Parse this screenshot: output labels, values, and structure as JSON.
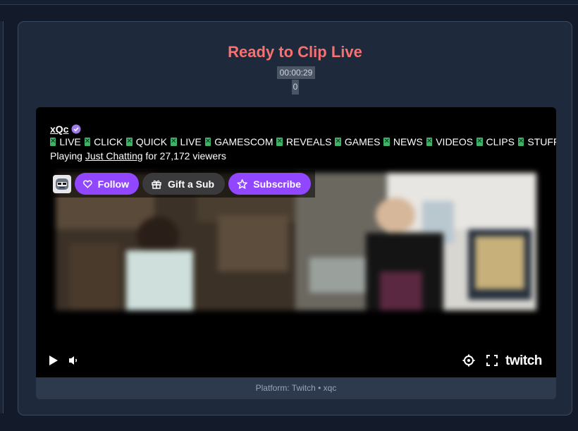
{
  "header": {
    "title": "Ready to Clip Live",
    "timer": "00:00:29",
    "counter": "0"
  },
  "stream": {
    "channel": "xQc",
    "title_words": [
      "LIVE",
      "CLICK",
      "QUICK",
      "LIVE",
      "GAMESCOM",
      "REVEALS",
      "GAMES",
      "NEWS",
      "VIDEOS",
      "CLIPS",
      "STUFF"
    ],
    "playing_prefix": "Playing",
    "game": "Just Chatting",
    "viewers_text": "for 27,172 viewers"
  },
  "actions": {
    "follow_label": "Follow",
    "gift_label": "Gift a Sub",
    "subscribe_label": "Subscribe"
  },
  "controls": {
    "play_icon": "play-icon",
    "volume_icon": "volume-icon",
    "settings_icon": "settings-icon",
    "fullscreen_icon": "fullscreen-icon",
    "brand": "twitch"
  },
  "footer": {
    "platform_label": "Platform: Twitch",
    "separator": "•",
    "channel_slug": "xqc"
  },
  "colors": {
    "title": "#f87171",
    "twitch_purple": "#9147ff",
    "card_bg": "#1e293b",
    "page_bg": "#131b2b"
  }
}
